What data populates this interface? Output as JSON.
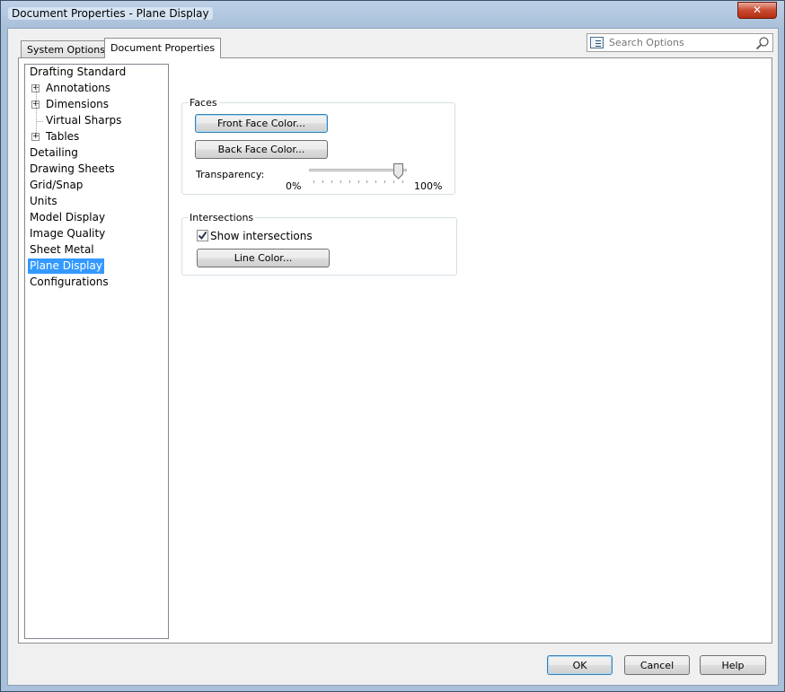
{
  "window": {
    "title": "Document Properties - Plane Display",
    "close_glyph": "✕"
  },
  "tabs": {
    "system_options": "System Options",
    "document_properties": "Document Properties"
  },
  "search": {
    "placeholder": "Search Options"
  },
  "tree": {
    "items": [
      {
        "label": "Drafting Standard",
        "expandable": false
      },
      {
        "label": "Annotations",
        "expandable": true
      },
      {
        "label": "Dimensions",
        "expandable": true
      },
      {
        "label": "Virtual Sharps",
        "expandable": false
      },
      {
        "label": "Tables",
        "expandable": true
      },
      {
        "label": "Detailing",
        "expandable": false
      },
      {
        "label": "Drawing Sheets",
        "expandable": false
      },
      {
        "label": "Grid/Snap",
        "expandable": false
      },
      {
        "label": "Units",
        "expandable": false
      },
      {
        "label": "Model Display",
        "expandable": false
      },
      {
        "label": "Image Quality",
        "expandable": false
      },
      {
        "label": "Sheet Metal",
        "expandable": false
      },
      {
        "label": "Plane Display",
        "expandable": false,
        "selected": true
      },
      {
        "label": "Configurations",
        "expandable": false
      }
    ],
    "expand_glyph": "+"
  },
  "faces": {
    "group_label": "Faces",
    "front_face_button": "Front Face Color...",
    "back_face_button": "Back Face Color...",
    "transparency_label": "Transparency:",
    "transparency_min": "0%",
    "transparency_max": "100%",
    "transparency_value": 0.95
  },
  "intersections": {
    "group_label": "Intersections",
    "show_intersections_label": "Show intersections",
    "show_intersections_checked": true,
    "line_color_button": "Line Color..."
  },
  "footer": {
    "ok": "OK",
    "cancel": "Cancel",
    "help": "Help"
  },
  "colors": {
    "selection": "#3399ff",
    "title_gradient": "#a9c0da",
    "close_button": "#c84a30"
  }
}
